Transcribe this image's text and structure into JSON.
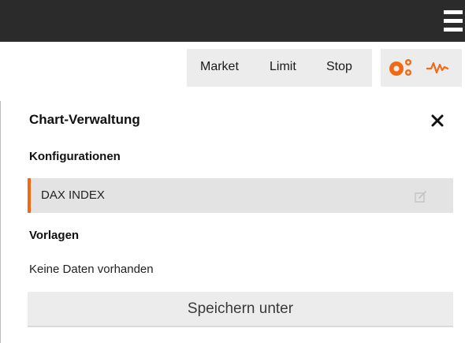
{
  "topbar": {
    "menu_icon": "hamburger-menu-icon"
  },
  "orderbar": {
    "market_label": "Market",
    "limit_label": "Limit",
    "stop_label": "Stop"
  },
  "toolbar_icons": [
    {
      "icon": "circles-icon",
      "color": "#f06a14"
    },
    {
      "icon": "pulse-chart-icon",
      "color": "#f06a14"
    }
  ],
  "panel": {
    "title": "Chart-Verwaltung",
    "close_icon": "close-icon",
    "configurations": {
      "heading": "Konfigurationen",
      "items": [
        {
          "label": "DAX INDEX",
          "accent_color": "#f06a14",
          "action_icon": "edit-icon"
        }
      ]
    },
    "templates": {
      "heading": "Vorlagen",
      "empty_text": "Keine Daten vorhanden"
    },
    "save_label": "Speichern unter"
  },
  "colors": {
    "topbar_bg": "#2b2b2b",
    "accent": "#f06a14",
    "button_bg": "#ececec",
    "row_bg": "#e3e3e3"
  }
}
